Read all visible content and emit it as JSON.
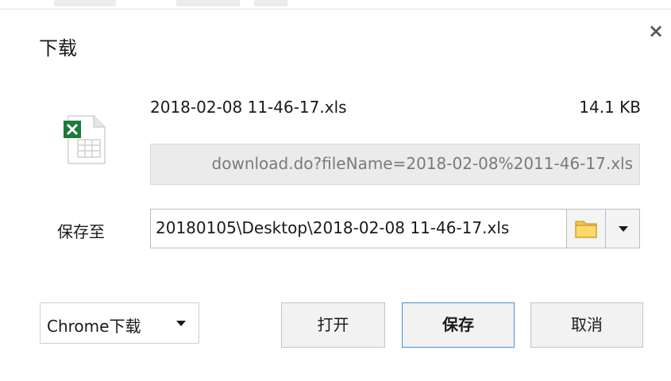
{
  "dialog": {
    "title": "下载",
    "close_label": "×"
  },
  "file": {
    "icon": "excel-file-icon",
    "name": "2018-02-08 11-46-17.xls",
    "size": "14.1 KB",
    "url": "download.do?fileName=2018-02-08%2011-46-17.xls"
  },
  "save": {
    "label": "保存至",
    "path": "20180105\\Desktop\\2018-02-08 11-46-17.xls",
    "folder_icon": "folder-icon"
  },
  "location": {
    "selected": "Chrome下载"
  },
  "buttons": {
    "open": "打开",
    "save": "保存",
    "cancel": "取消"
  },
  "colors": {
    "excel_green": "#1d7a3a",
    "folder_yellow": "#f5c542",
    "primary_border": "#4a90d9"
  }
}
